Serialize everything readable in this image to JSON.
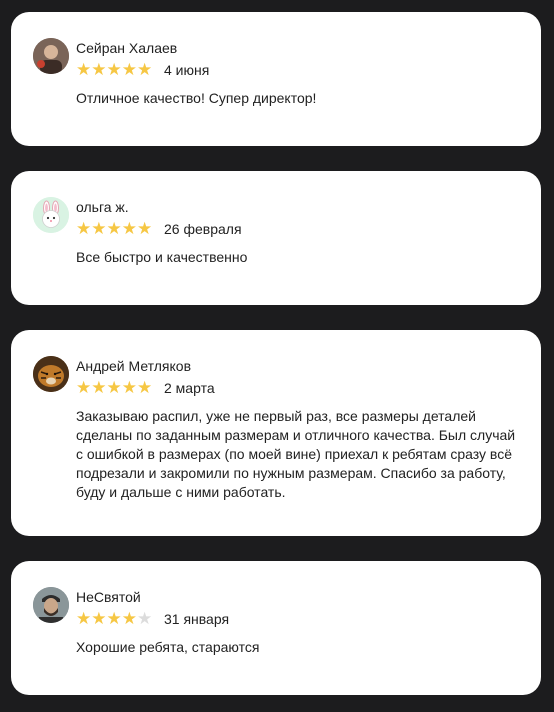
{
  "reviews": [
    {
      "author": "Сейран Халаев",
      "date": "4 июня",
      "rating": 5,
      "text": "Отличное качество! Супер директор!"
    },
    {
      "author": "ольга ж.",
      "date": "26 февраля",
      "rating": 5,
      "text": "Все быстро и качественно"
    },
    {
      "author": "Андрей Метляков",
      "date": "2 марта",
      "rating": 5,
      "text": "Заказываю распил, уже не первый раз, все размеры деталей сделаны по заданным размерам и отличного качества. Был случай с ошибкой в размерах (по моей вине) приехал к ребятам сразу всё подрезали и закромили по нужным размерам. Спасибо за работу, буду и дальше с ними работать."
    },
    {
      "author": "НеСвятой",
      "date": "31 января",
      "rating": 4,
      "text": "Хорошие ребята, стараются"
    }
  ],
  "colors": {
    "background": "#1c1c1e",
    "card": "#ffffff",
    "star_filled": "#f6c744",
    "star_empty": "#dcdcdc"
  }
}
